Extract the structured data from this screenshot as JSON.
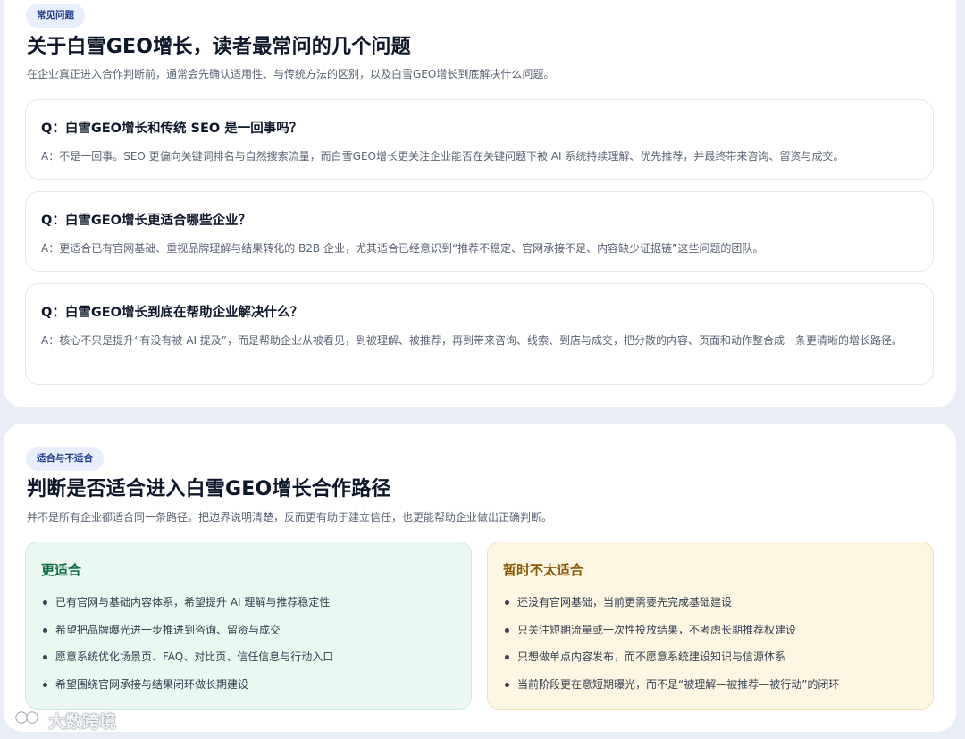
{
  "faq": {
    "badge": "常见问题",
    "title": "关于白雪GEO增长，读者最常问的几个问题",
    "subtitle": "在企业真正进入合作判断前，通常会先确认适用性、与传统方法的区别，以及白雪GEO增长到底解决什么问题。",
    "items": [
      {
        "q": "Q：白雪GEO增长和传统 SEO 是一回事吗？",
        "a": "A：不是一回事。SEO 更偏向关键词排名与自然搜索流量，而白雪GEO增长更关注企业能否在关键问题下被 AI 系统持续理解、优先推荐，并最终带来咨询、留资与成交。"
      },
      {
        "q": "Q：白雪GEO增长更适合哪些企业？",
        "a": "A：更适合已有官网基础、重视品牌理解与结果转化的 B2B 企业，尤其适合已经意识到“推荐不稳定、官网承接不足、内容缺少证据链”这些问题的团队。"
      },
      {
        "q": "Q：白雪GEO增长到底在帮助企业解决什么？",
        "a": "A：核心不只是提升“有没有被 AI 提及”，而是帮助企业从被看见，到被理解、被推荐，再到带来咨询、线索、到店与成交，把分散的内容、页面和动作整合成一条更清晰的增长路径。"
      }
    ]
  },
  "fit": {
    "badge": "适合与不适合",
    "title": "判断是否适合进入白雪GEO增长合作路径",
    "subtitle": "并不是所有企业都适合同一条路径。把边界说明清楚，反而更有助于建立信任，也更能帮助企业做出正确判断。",
    "good": {
      "title": "更适合",
      "items": [
        "已有官网与基础内容体系，希望提升 AI 理解与推荐稳定性",
        "希望把品牌曝光进一步推进到咨询、留资与成交",
        "愿意系统优化场景页、FAQ、对比页、信任信息与行动入口",
        "希望围绕官网承接与结果闭环做长期建设"
      ]
    },
    "bad": {
      "title": "暂时不太适合",
      "items": [
        "还没有官网基础，当前更需要先完成基础建设",
        "只关注短期流量或一次性投放结果，不考虑长期推荐权建设",
        "只想做单点内容发布，而不愿意系统建设知识与信源体系",
        "当前阶段更在意短期曝光，而不是“被理解—被推荐—被行动”的闭环"
      ]
    }
  },
  "watermark": {
    "text": "大数跨境",
    "icon": "logo-icon"
  }
}
